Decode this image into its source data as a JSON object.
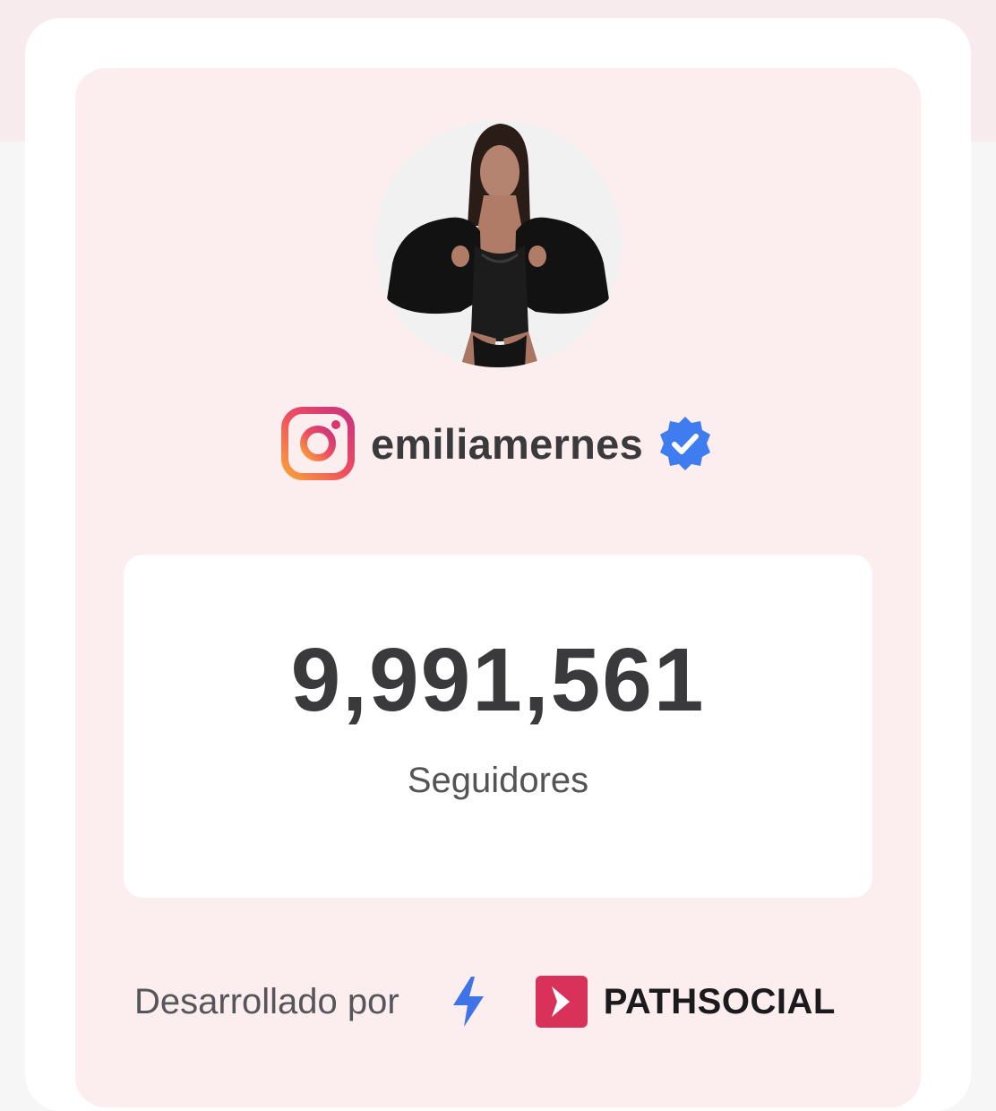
{
  "profile": {
    "username": "emiliamernes",
    "avatar_icon": "profile-photo",
    "platform_icon": "instagram-icon",
    "verified_icon": "verified-badge-icon"
  },
  "stats": {
    "followers_value": "9,991,561",
    "followers_label": "Seguidores"
  },
  "footer": {
    "powered_by": "Desarrollado por",
    "bolt_icon": "lightning-bolt-icon",
    "brand_icon": "pathsocial-logo-icon",
    "brand_name": "PATHSOCIAL"
  },
  "colors": {
    "panel_bg": "#fcedee",
    "card_bg": "#ffffff",
    "verified_blue": "#3f7cf0",
    "brand_red": "#d8325a",
    "text_dark": "#3a3a3c"
  }
}
